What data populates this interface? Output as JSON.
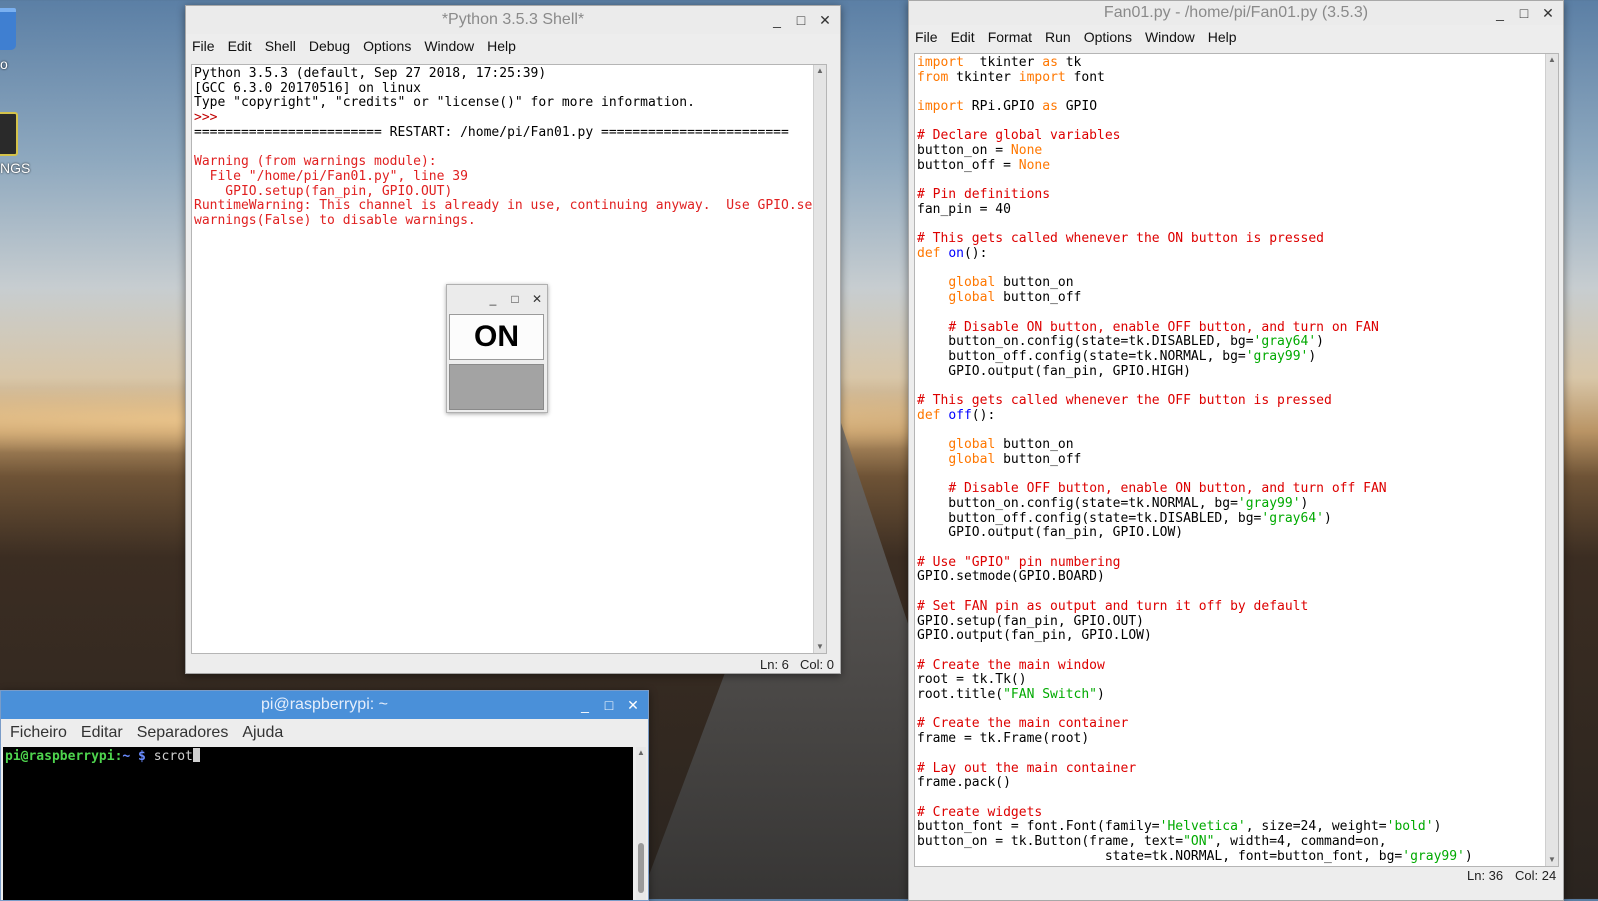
{
  "desktop": {
    "labels": [
      "o",
      "NGS"
    ]
  },
  "shell_window": {
    "title": "*Python 3.5.3 Shell*",
    "menu": [
      "File",
      "Edit",
      "Shell",
      "Debug",
      "Options",
      "Window",
      "Help"
    ],
    "lines": [
      {
        "cls": "c-out",
        "text": "Python 3.5.3 (default, Sep 27 2018, 17:25:39)"
      },
      {
        "cls": "c-out",
        "text": "[GCC 6.3.0 20170516] on linux"
      },
      {
        "cls": "c-out",
        "text": "Type \"copyright\", \"credits\" or \"license()\" for more information."
      },
      {
        "cls": "c-prompt",
        "text": ">>> "
      },
      {
        "cls": "c-out",
        "text": "======================== RESTART: /home/pi/Fan01.py ========================"
      },
      {
        "cls": "c-out",
        "text": ""
      },
      {
        "cls": "c-err",
        "text": "Warning (from warnings module):"
      },
      {
        "cls": "c-err",
        "text": "  File \"/home/pi/Fan01.py\", line 39"
      },
      {
        "cls": "c-err",
        "text": "    GPIO.setup(fan_pin, GPIO.OUT)"
      },
      {
        "cls": "c-err",
        "text": "RuntimeWarning: This channel is already in use, continuing anyway.  Use GPIO.set"
      },
      {
        "cls": "c-err",
        "text": "warnings(False) to disable warnings."
      }
    ],
    "status": {
      "ln": "Ln: 6",
      "col": "Col: 0"
    }
  },
  "fan_switch": {
    "on_label": "ON"
  },
  "editor_window": {
    "title": "Fan01.py - /home/pi/Fan01.py (3.5.3)",
    "menu": [
      "File",
      "Edit",
      "Format",
      "Run",
      "Options",
      "Window",
      "Help"
    ],
    "code": [
      [
        [
          "kw",
          "import"
        ],
        [
          "",
          "  tkinter "
        ],
        [
          "kw",
          "as"
        ],
        [
          "",
          " tk"
        ]
      ],
      [
        [
          "kw",
          "from"
        ],
        [
          "",
          " tkinter "
        ],
        [
          "kw",
          "import"
        ],
        [
          "",
          " font"
        ]
      ],
      [
        [
          "",
          ""
        ]
      ],
      [
        [
          "kw",
          "import"
        ],
        [
          "",
          " RPi.GPIO "
        ],
        [
          "kw",
          "as"
        ],
        [
          "",
          " GPIO"
        ]
      ],
      [
        [
          "",
          ""
        ]
      ],
      [
        [
          "cm",
          "# Declare global variables"
        ]
      ],
      [
        [
          "",
          "button_on = "
        ],
        [
          "kw",
          "None"
        ]
      ],
      [
        [
          "",
          "button_off = "
        ],
        [
          "kw",
          "None"
        ]
      ],
      [
        [
          "",
          ""
        ]
      ],
      [
        [
          "cm",
          "# Pin definitions"
        ]
      ],
      [
        [
          "",
          "fan_pin = 40"
        ]
      ],
      [
        [
          "",
          ""
        ]
      ],
      [
        [
          "cm",
          "# This gets called whenever the ON button is pressed"
        ]
      ],
      [
        [
          "kw",
          "def"
        ],
        [
          "",
          " "
        ],
        [
          "df",
          "on"
        ],
        [
          "",
          "():"
        ]
      ],
      [
        [
          "",
          ""
        ]
      ],
      [
        [
          "",
          "    "
        ],
        [
          "kw",
          "global"
        ],
        [
          "",
          " button_on"
        ]
      ],
      [
        [
          "",
          "    "
        ],
        [
          "kw",
          "global"
        ],
        [
          "",
          " button_off"
        ]
      ],
      [
        [
          "",
          ""
        ]
      ],
      [
        [
          "",
          "    "
        ],
        [
          "cm",
          "# Disable ON button, enable OFF button, and turn on FAN"
        ]
      ],
      [
        [
          "",
          "    button_on.config(state=tk.DISABLED, bg="
        ],
        [
          "st-g",
          "'gray64'"
        ],
        [
          "",
          ")"
        ]
      ],
      [
        [
          "",
          "    button_off.config(state=tk.NORMAL, bg="
        ],
        [
          "st-g",
          "'gray99'"
        ],
        [
          "",
          ")"
        ]
      ],
      [
        [
          "",
          "    GPIO.output(fan_pin, GPIO.HIGH)"
        ]
      ],
      [
        [
          "",
          ""
        ]
      ],
      [
        [
          "cm",
          "# This gets called whenever the OFF button is pressed"
        ]
      ],
      [
        [
          "kw",
          "def"
        ],
        [
          "",
          " "
        ],
        [
          "df",
          "off"
        ],
        [
          "",
          "():"
        ]
      ],
      [
        [
          "",
          ""
        ]
      ],
      [
        [
          "",
          "    "
        ],
        [
          "kw",
          "global"
        ],
        [
          "",
          " button_on"
        ]
      ],
      [
        [
          "",
          "    "
        ],
        [
          "kw",
          "global"
        ],
        [
          "",
          " button_off"
        ]
      ],
      [
        [
          "",
          ""
        ]
      ],
      [
        [
          "",
          "    "
        ],
        [
          "cm",
          "# Disable OFF button, enable ON button, and turn off FAN"
        ]
      ],
      [
        [
          "",
          "    button_on.config(state=tk.NORMAL, bg="
        ],
        [
          "st-g",
          "'gray99'"
        ],
        [
          "",
          ")"
        ]
      ],
      [
        [
          "",
          "    button_off.config(state=tk.DISABLED, bg="
        ],
        [
          "st-g",
          "'gray64'"
        ],
        [
          "",
          ")"
        ]
      ],
      [
        [
          "",
          "    GPIO.output(fan_pin, GPIO.LOW)"
        ]
      ],
      [
        [
          "",
          ""
        ]
      ],
      [
        [
          "cm",
          "# Use \"GPIO\" pin numbering"
        ]
      ],
      [
        [
          "",
          "GPIO.setmode(GPIO.BOARD)"
        ]
      ],
      [
        [
          "",
          ""
        ]
      ],
      [
        [
          "cm",
          "# Set FAN pin as output and turn it off by default"
        ]
      ],
      [
        [
          "",
          "GPIO.setup(fan_pin, GPIO.OUT)"
        ]
      ],
      [
        [
          "",
          "GPIO.output(fan_pin, GPIO.LOW)"
        ]
      ],
      [
        [
          "",
          ""
        ]
      ],
      [
        [
          "cm",
          "# Create the main window"
        ]
      ],
      [
        [
          "",
          "root = tk.Tk()"
        ]
      ],
      [
        [
          "",
          "root.title("
        ],
        [
          "st-g",
          "\"FAN Switch\""
        ],
        [
          "",
          ")"
        ]
      ],
      [
        [
          "",
          ""
        ]
      ],
      [
        [
          "cm",
          "# Create the main container"
        ]
      ],
      [
        [
          "",
          "frame = tk.Frame(root)"
        ]
      ],
      [
        [
          "",
          ""
        ]
      ],
      [
        [
          "cm",
          "# Lay out the main container"
        ]
      ],
      [
        [
          "",
          "frame.pack()"
        ]
      ],
      [
        [
          "",
          ""
        ]
      ],
      [
        [
          "cm",
          "# Create widgets"
        ]
      ],
      [
        [
          "",
          "button_font = font.Font(family="
        ],
        [
          "st-g",
          "'Helvetica'"
        ],
        [
          "",
          ", size=24, weight="
        ],
        [
          "st-g",
          "'bold'"
        ],
        [
          "",
          ")"
        ]
      ],
      [
        [
          "",
          "button_on = tk.Button(frame, text="
        ],
        [
          "st-g",
          "\"ON\""
        ],
        [
          "",
          ", width=4, command=on,"
        ]
      ],
      [
        [
          "",
          "                        state=tk.NORMAL, font=button_font, bg="
        ],
        [
          "st-g",
          "'gray99'"
        ],
        [
          "",
          ")"
        ]
      ]
    ],
    "status": {
      "ln": "Ln: 36",
      "col": "Col: 24"
    }
  },
  "terminal": {
    "title": "pi@raspberrypi: ~",
    "menu": [
      "Ficheiro",
      "Editar",
      "Separadores",
      "Ajuda"
    ],
    "prompt_user": "pi@raspberrypi",
    "prompt_sep": ":",
    "prompt_path": "~",
    "prompt_dollar": " $ ",
    "command": "scrot"
  },
  "window_controls": {
    "minimize": "_",
    "maximize": "□",
    "close": "✕"
  }
}
